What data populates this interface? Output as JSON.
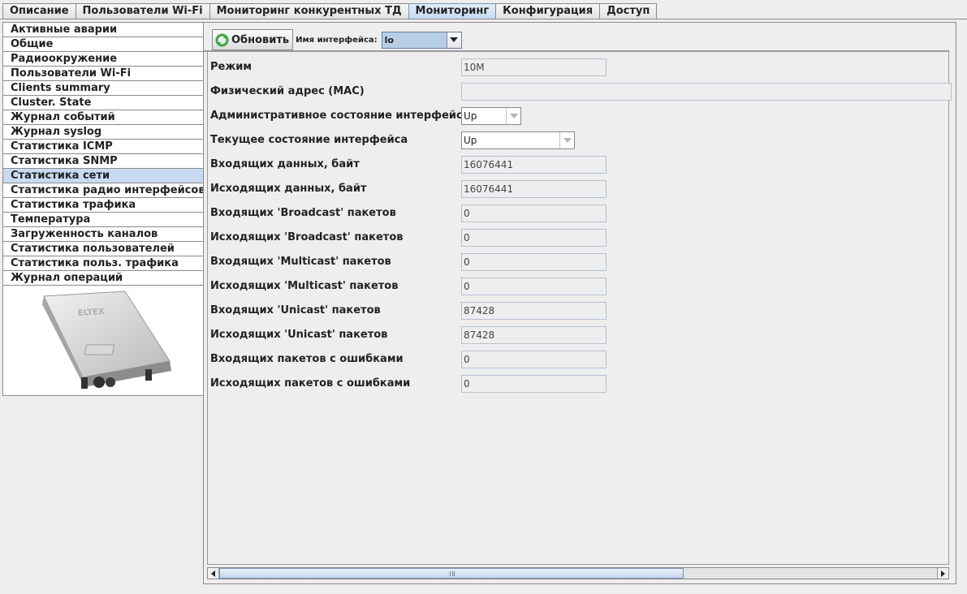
{
  "tabs": [
    {
      "label": "Описание",
      "active": false
    },
    {
      "label": "Пользователи Wi-Fi",
      "active": false
    },
    {
      "label": "Мониторинг конкурентных ТД",
      "active": false
    },
    {
      "label": "Мониторинг",
      "active": true
    },
    {
      "label": "Конфигурация",
      "active": false
    },
    {
      "label": "Доступ",
      "active": false
    }
  ],
  "sidebar": {
    "selected_index": 10,
    "items": [
      {
        "label": "Активные аварии"
      },
      {
        "label": "Общие"
      },
      {
        "label": "Радиоокружение"
      },
      {
        "label": "Пользователи Wi-Fi"
      },
      {
        "label": "Clients summary"
      },
      {
        "label": "Cluster. State"
      },
      {
        "label": "Журнал событий"
      },
      {
        "label": "Журнал syslog"
      },
      {
        "label": "Статистика ICMP"
      },
      {
        "label": "Статистика SNMP"
      },
      {
        "label": "Статистика сети"
      },
      {
        "label": "Статистика радио интерфейсов"
      },
      {
        "label": "Статистика трафика"
      },
      {
        "label": "Температура"
      },
      {
        "label": "Загруженность каналов"
      },
      {
        "label": "Статистика пользователей"
      },
      {
        "label": "Статистика польз. трафика"
      },
      {
        "label": "Журнал операций"
      }
    ],
    "device_logo_text": "ELTEX"
  },
  "toolbar": {
    "refresh_label": "Обновить",
    "interface_label": "Имя интерфейса:",
    "interface_value": "lo"
  },
  "fields": {
    "mode": {
      "label": "Режим",
      "value": "10M"
    },
    "mac": {
      "label": "Физический адрес (MAC)",
      "value": ""
    },
    "admin_state": {
      "label": "Административное состояние интерфейса",
      "value": "Up"
    },
    "oper_state": {
      "label": "Текущее состояние интерфейса",
      "value": "Up"
    },
    "rx_bytes": {
      "label": "Входящих данных, байт",
      "value": "16076441"
    },
    "tx_bytes": {
      "label": "Исходящих данных, байт",
      "value": "16076441"
    },
    "rx_broadcast": {
      "label": "Входящих 'Broadcast' пакетов",
      "value": "0"
    },
    "tx_broadcast": {
      "label": "Исходящих 'Broadcast' пакетов",
      "value": "0"
    },
    "rx_multicast": {
      "label": "Входящих 'Multicast' пакетов",
      "value": "0"
    },
    "tx_multicast": {
      "label": "Исходящих 'Multicast' пакетов",
      "value": "0"
    },
    "rx_unicast": {
      "label": "Входящих 'Unicast' пакетов",
      "value": "87428"
    },
    "tx_unicast": {
      "label": "Исходящих 'Unicast' пакетов",
      "value": "87428"
    },
    "rx_errors": {
      "label": "Входящих пакетов с ошибками",
      "value": "0"
    },
    "tx_errors": {
      "label": "Исходящих пакетов с ошибками",
      "value": "0"
    }
  },
  "colors": {
    "accent": "#c8daf1",
    "refresh_icon": "#3fa845"
  }
}
